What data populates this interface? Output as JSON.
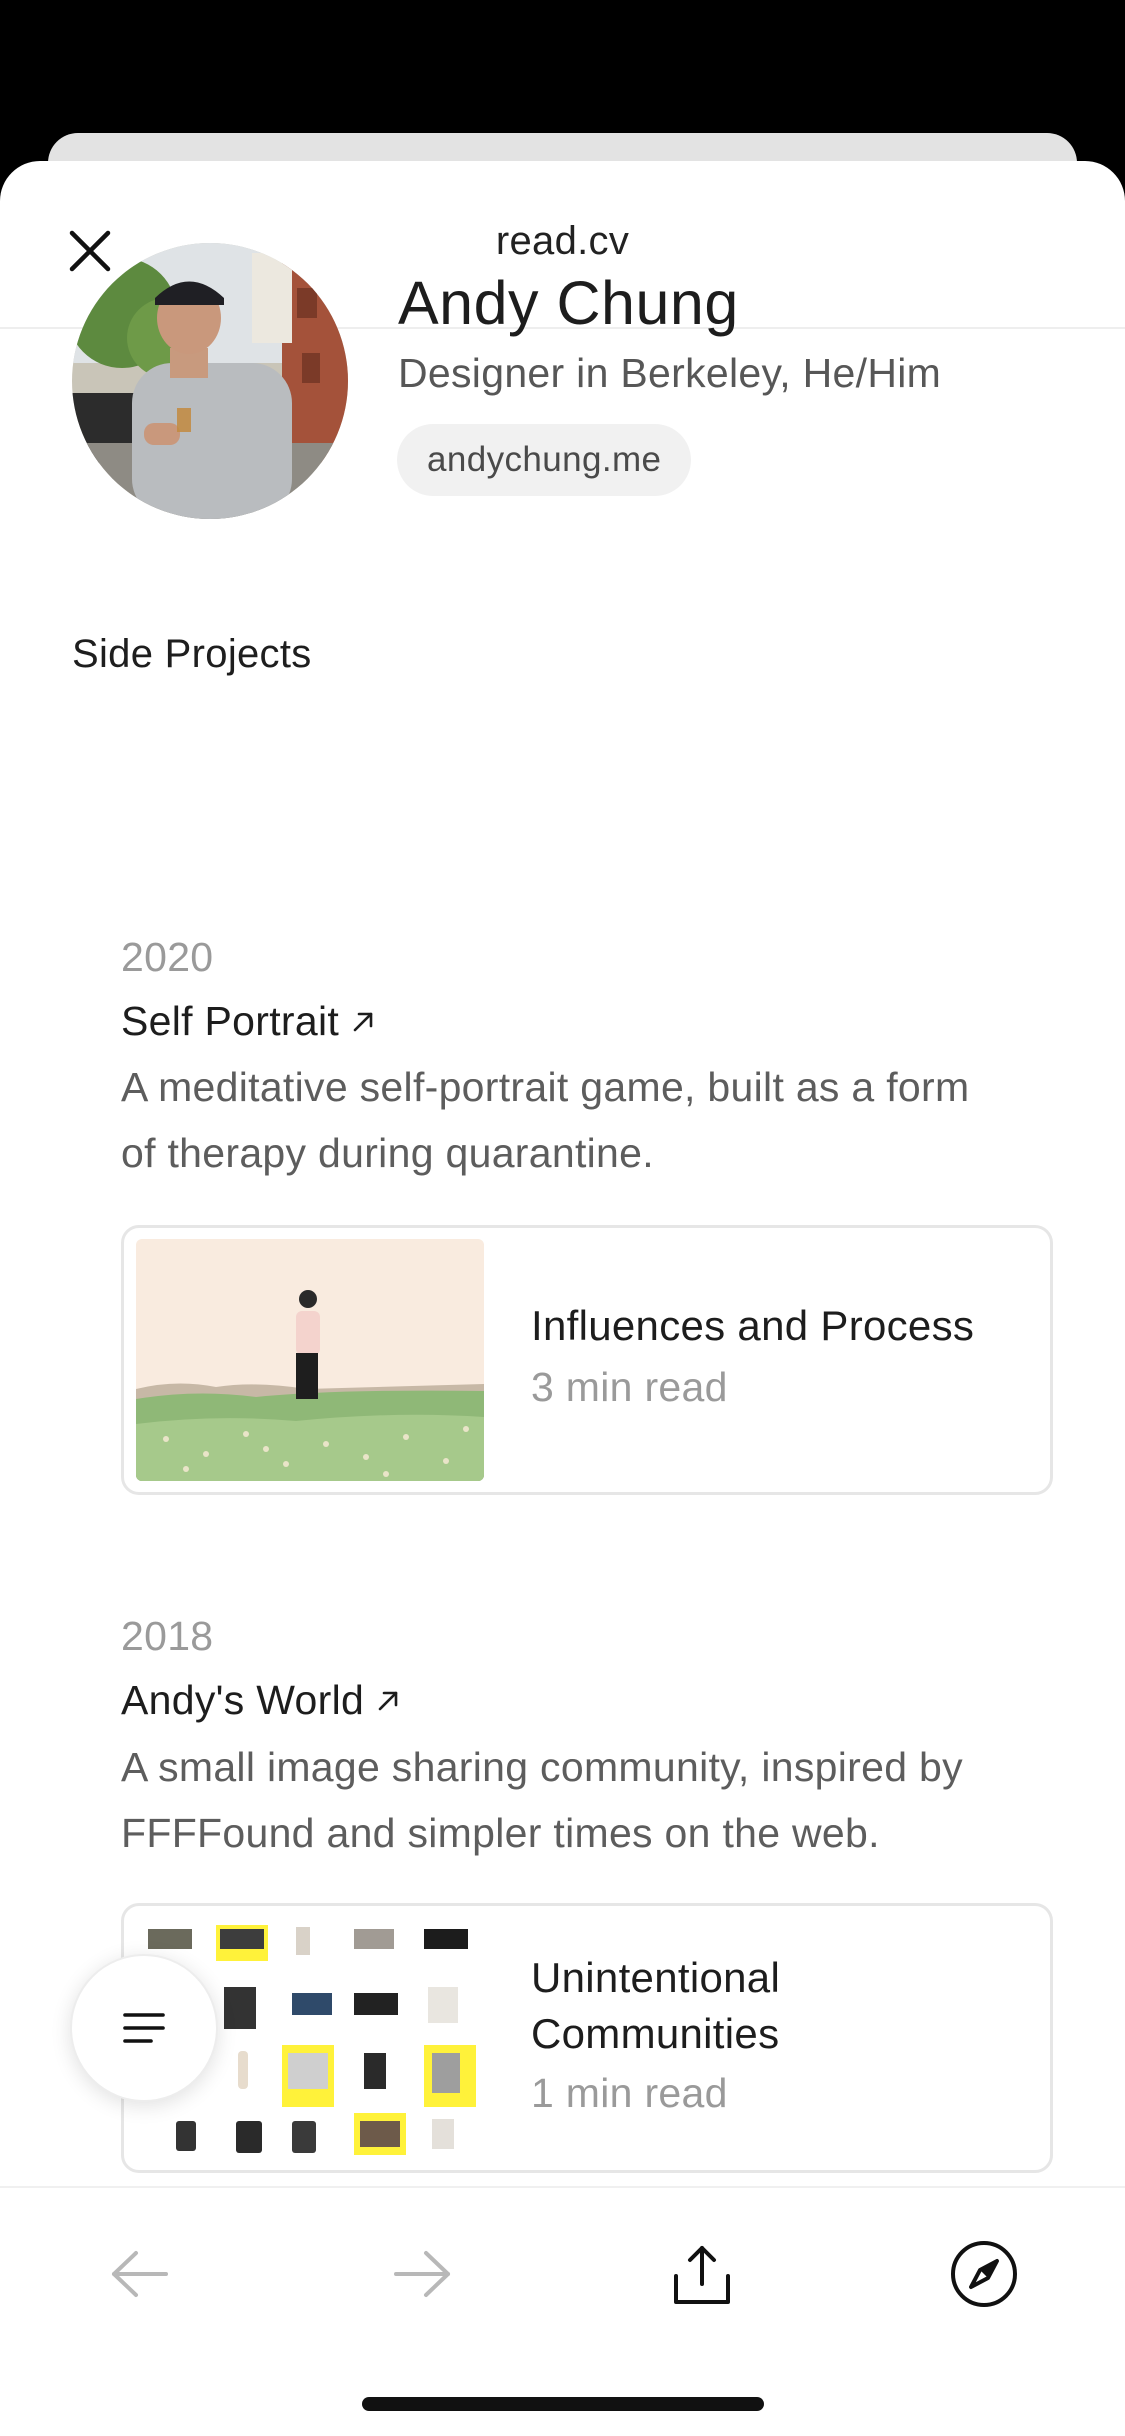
{
  "header": {
    "title": "read.cv"
  },
  "profile": {
    "name": "Andy Chung",
    "subtitle": "Designer in Berkeley, He/Him",
    "website": "andychung.me"
  },
  "section": {
    "title": "Side Projects"
  },
  "projects": [
    {
      "year": "2020",
      "title": "Self Portrait",
      "description_line1": "A meditative self-portrait game, built as a form",
      "description_line2": "of therapy during quarantine.",
      "card": {
        "title": "Influences and Process",
        "meta": "3 min read"
      }
    },
    {
      "year": "2018",
      "title": "Andy's World",
      "description_line1": "A small image sharing community, inspired by",
      "description_line2": "FFFFound and simpler times on the web.",
      "card": {
        "title_line1": "Unintentional",
        "title_line2": "Communities",
        "meta": "1 min read"
      }
    }
  ],
  "toolbar": {
    "icons": [
      "arrow-left-icon",
      "arrow-right-icon",
      "share-icon",
      "compass-icon"
    ]
  },
  "colors": {
    "text_primary": "#1d1d1d",
    "text_secondary": "#5d5d5d",
    "text_muted": "#9a9a9a",
    "chip_bg": "#f1f1f1",
    "highlight_yellow": "#fff23a"
  }
}
